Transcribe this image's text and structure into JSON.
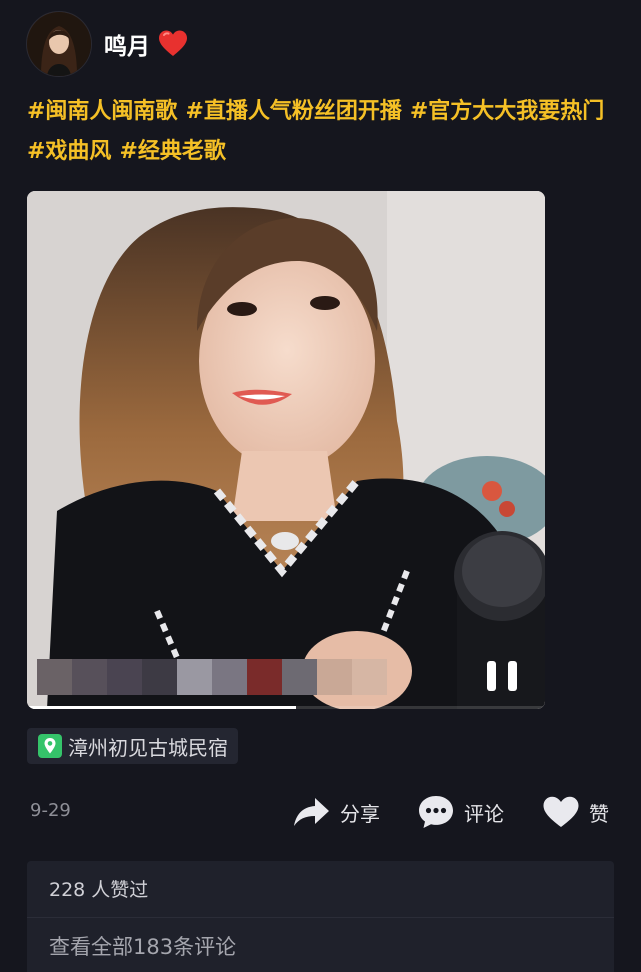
{
  "post": {
    "author": {
      "name": "鸣月",
      "avatar_icon": "avatar-photo",
      "emoji_icon": "red-heart-emoji"
    },
    "hashtags": [
      "#闽南人闽南歌",
      "#直播人气粉丝团开播",
      "#官方大大我要热门",
      "#戏曲风",
      "#经典老歌"
    ],
    "video": {
      "state": "playing",
      "control_icon": "pause-icon",
      "progress": 0.52
    },
    "location": {
      "icon": "location-pin-icon",
      "label": "漳州初见古城民宿"
    },
    "date": "9-29",
    "actions": {
      "share_label": "分享",
      "comment_label": "评论",
      "like_label": "赞"
    },
    "stats": {
      "likes_text": "228 人赞过",
      "view_comments_text": "查看全部183条评论"
    }
  },
  "colors": {
    "background": "#15161e",
    "hashtag": "#f5c026",
    "location_bg": "#242631",
    "location_icon": "#35c46a",
    "stats_bg": "#1f212b"
  }
}
